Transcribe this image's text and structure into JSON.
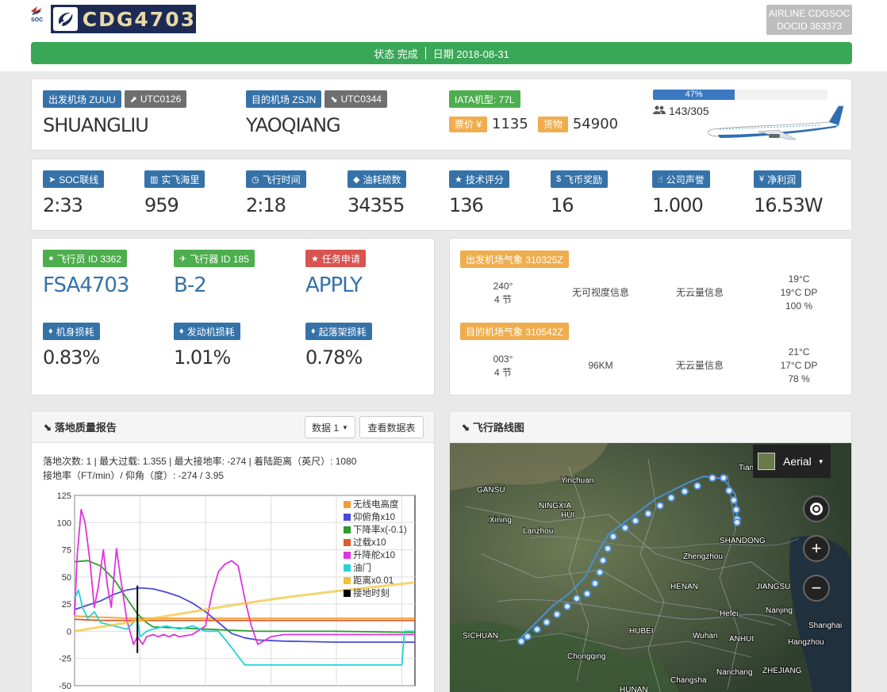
{
  "header": {
    "soc_label": "SOC",
    "flight_code": "CDG4703",
    "airline_line1": "AIRLINE CDGSOC",
    "airline_line2": "DOCID 363373"
  },
  "status": {
    "state": "状态 完成",
    "date": "日期 2018-08-31"
  },
  "flight": {
    "dep_label": "出发机场 ZUUU",
    "dep_time": "UTC0126",
    "dep_name": "SHUANGLIU",
    "arr_label": "目的机场 ZSJN",
    "arr_time": "UTC0344",
    "arr_name": "YAOQIANG",
    "iata": "IATA机型: 77L",
    "price_label": "票价 ¥",
    "price": "1135",
    "cargo_label": "货物",
    "cargo": "54900",
    "load_percent": 47,
    "load_percent_text": "47%",
    "pax": "143/305"
  },
  "stats": [
    {
      "label": "SOC联线",
      "icon": "send-icon",
      "value": "2:33"
    },
    {
      "label": "实飞海里",
      "icon": "map-icon",
      "value": "959"
    },
    {
      "label": "飞行时间",
      "icon": "clock-icon",
      "value": "2:18"
    },
    {
      "label": "油耗磅数",
      "icon": "drop-icon",
      "value": "34355"
    },
    {
      "label": "技术评分",
      "icon": "star-icon",
      "value": "136"
    },
    {
      "label": "飞币奖励",
      "icon": "dollar-icon",
      "value": "16"
    },
    {
      "label": "公司声誉",
      "icon": "thumbs-up-icon",
      "value": "1.000"
    },
    {
      "label": "净利润",
      "icon": "yen-icon",
      "value": "16.53W"
    }
  ],
  "pilot": {
    "pilot_label": "飞行员 ID 3362",
    "pilot_value": "FSA4703",
    "aircraft_label": "飞行器 ID 185",
    "aircraft_value": "B-2",
    "task_label": "任务申请",
    "task_value": "APPLY",
    "body_label": "机身损耗",
    "body_value": "0.83%",
    "engine_label": "发动机损耗",
    "engine_value": "1.01%",
    "gear_label": "起落架损耗",
    "gear_value": "0.78%"
  },
  "weather": {
    "dep_label": "出发机场气象 310325Z",
    "dep_wind_dir": "240°",
    "dep_wind_spd": "4 节",
    "dep_vis": "无可视度信息",
    "dep_cloud": "无云量信息",
    "dep_temp": "19°C",
    "dep_dp": "19°C DP",
    "dep_hum": "100 %",
    "arr_label": "目的机场气象 310542Z",
    "arr_wind_dir": "003°",
    "arr_wind_spd": "4 节",
    "arr_vis": "96KM",
    "arr_cloud": "无云量信息",
    "arr_temp": "21°C",
    "arr_dp": "17°C DP",
    "arr_hum": "78 %"
  },
  "landing": {
    "title": "落地质量报告",
    "dropdown": "数据 1",
    "view_table": "查看数据表",
    "summary1": "落地次数: 1 | 最大过载: 1.355 | 最大接地率: -274 | 着陆距离（英尺）: 1080",
    "summary2": "接地率（FT/min）/ 仰角（度）: -274 / 3.95"
  },
  "chart_data": {
    "type": "line",
    "ylim": [
      -50,
      125
    ],
    "xlim": [
      0,
      26
    ],
    "yticks": [
      "125",
      "100",
      "75",
      "50",
      "25",
      "0",
      "-25",
      "-50"
    ],
    "grid": true,
    "legend_position": "top-right",
    "touchdown_x": 4.8,
    "series": [
      {
        "name": "无线电高度",
        "color": "#f39c34",
        "x": [
          0,
          2,
          4,
          6,
          8,
          12,
          16,
          20,
          26
        ],
        "y": [
          14,
          13,
          12,
          12,
          12,
          12,
          12,
          12,
          12
        ]
      },
      {
        "name": "仰俯角x10",
        "color": "#4a4ad8",
        "x": [
          0,
          2,
          3,
          4,
          5,
          6,
          7,
          8,
          9,
          10,
          11,
          12,
          13,
          14,
          16,
          20,
          26
        ],
        "y": [
          20,
          28,
          34,
          38,
          40,
          39,
          36,
          32,
          26,
          18,
          8,
          -2,
          -6,
          -8,
          -9,
          -10,
          -10
        ]
      },
      {
        "name": "下降率x(-0.1)",
        "color": "#2a9d2a",
        "x": [
          0,
          1,
          2,
          3,
          4,
          4.8,
          5.5,
          6,
          8,
          10,
          12,
          14,
          16,
          20,
          26
        ],
        "y": [
          64,
          65,
          60,
          48,
          30,
          16,
          8,
          4,
          3,
          2,
          1,
          0,
          0,
          0,
          -1
        ]
      },
      {
        "name": "过载x10",
        "color": "#e05a2a",
        "x": [
          0,
          2,
          4,
          6,
          8,
          10,
          12,
          16,
          20,
          26
        ],
        "y": [
          11,
          10,
          10,
          10,
          10,
          10,
          10,
          10,
          10,
          10
        ]
      },
      {
        "name": "升降舵x10",
        "color": "#e033e0",
        "x": [
          0,
          0.2,
          0.5,
          0.8,
          1.2,
          1.5,
          1.8,
          2.2,
          2.5,
          2.8,
          3.2,
          3.5,
          4,
          4.5,
          4.8,
          5.2,
          5.5,
          6,
          6.4,
          6.8,
          7.2,
          7.6,
          8,
          9,
          10,
          10.5,
          11,
          11.5,
          12,
          12.5,
          13,
          13.5,
          14,
          15,
          16,
          20,
          26
        ],
        "y": [
          15,
          70,
          112,
          100,
          62,
          22,
          40,
          75,
          42,
          22,
          76,
          50,
          10,
          -12,
          -5,
          -12,
          -5,
          -3,
          -5,
          -3,
          -5,
          -3,
          -5,
          -3,
          5,
          35,
          55,
          62,
          65,
          60,
          30,
          5,
          -12,
          -5,
          -3,
          -3,
          -3
        ]
      },
      {
        "name": "油门",
        "color": "#22d4d8",
        "x": [
          0,
          0.3,
          0.6,
          1,
          1.5,
          2,
          3,
          4,
          4.8,
          5,
          5.5,
          6,
          7,
          8,
          9,
          10,
          11,
          12,
          13,
          20,
          25,
          25.2,
          25.5,
          26
        ],
        "y": [
          30,
          38,
          22,
          12,
          18,
          8,
          5,
          2,
          12,
          -5,
          0,
          2,
          5,
          2,
          5,
          0,
          0,
          -15,
          -31,
          -31,
          -31,
          0,
          0,
          0
        ]
      },
      {
        "name": "距离x0.01",
        "color": "#f2c232",
        "x": [
          0,
          4,
          8,
          12,
          16,
          20,
          26
        ],
        "y": [
          0,
          8,
          16,
          24,
          31,
          37,
          45
        ]
      },
      {
        "name": "接地时刻",
        "color": "#000000",
        "x": [
          4.8,
          4.8
        ],
        "y": [
          -20,
          42
        ]
      }
    ]
  },
  "map": {
    "title": "飞行路线图",
    "layer": "Aerial",
    "labels": [
      "Yinchuan",
      "GANSU",
      "NINGXIA HUI",
      "Xining",
      "Lanzhou",
      "Zhengzhou",
      "HENAN",
      "SHANDONG",
      "JIANGSU",
      "Hefei",
      "Nanjing",
      "Shanghai",
      "Hangzhou",
      "ANHUI",
      "HUBEI",
      "Wuhan",
      "SICHUAN",
      "Chongqing",
      "Changsha",
      "Nanchang",
      "ZHEJIANG",
      "HUNAN",
      "Tian"
    ]
  }
}
